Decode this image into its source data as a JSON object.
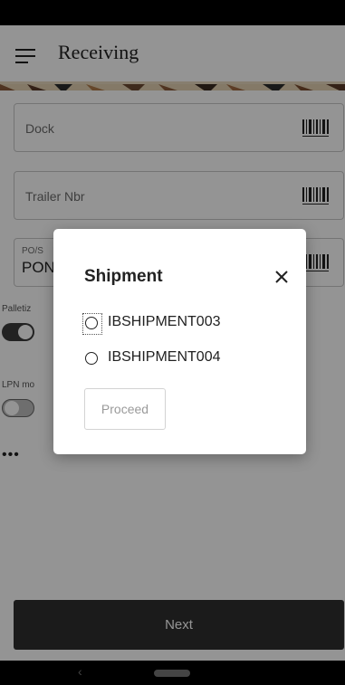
{
  "header": {
    "title": "Receiving"
  },
  "form": {
    "dock_label": "Dock",
    "trailer_label": "Trailer Nbr",
    "po_small_label": "PO/S",
    "po_value": "PON",
    "palletize_label": "Palletiz",
    "lpn_label": "LPN mo",
    "palletize_on": true,
    "lpn_on": false
  },
  "footer": {
    "next_label": "Next"
  },
  "dialog": {
    "title": "Shipment",
    "options": [
      {
        "label": "IBSHIPMENT003",
        "selected": false,
        "focused": true
      },
      {
        "label": "IBSHIPMENT004",
        "selected": false,
        "focused": false
      }
    ],
    "proceed_label": "Proceed"
  },
  "colors": {
    "toggle_on": "#3c3c3c",
    "button_dark": "#303030"
  },
  "icons": [
    "menu-icon",
    "barcode-icon",
    "more-icon",
    "close-icon",
    "back-icon",
    "home-icon"
  ]
}
